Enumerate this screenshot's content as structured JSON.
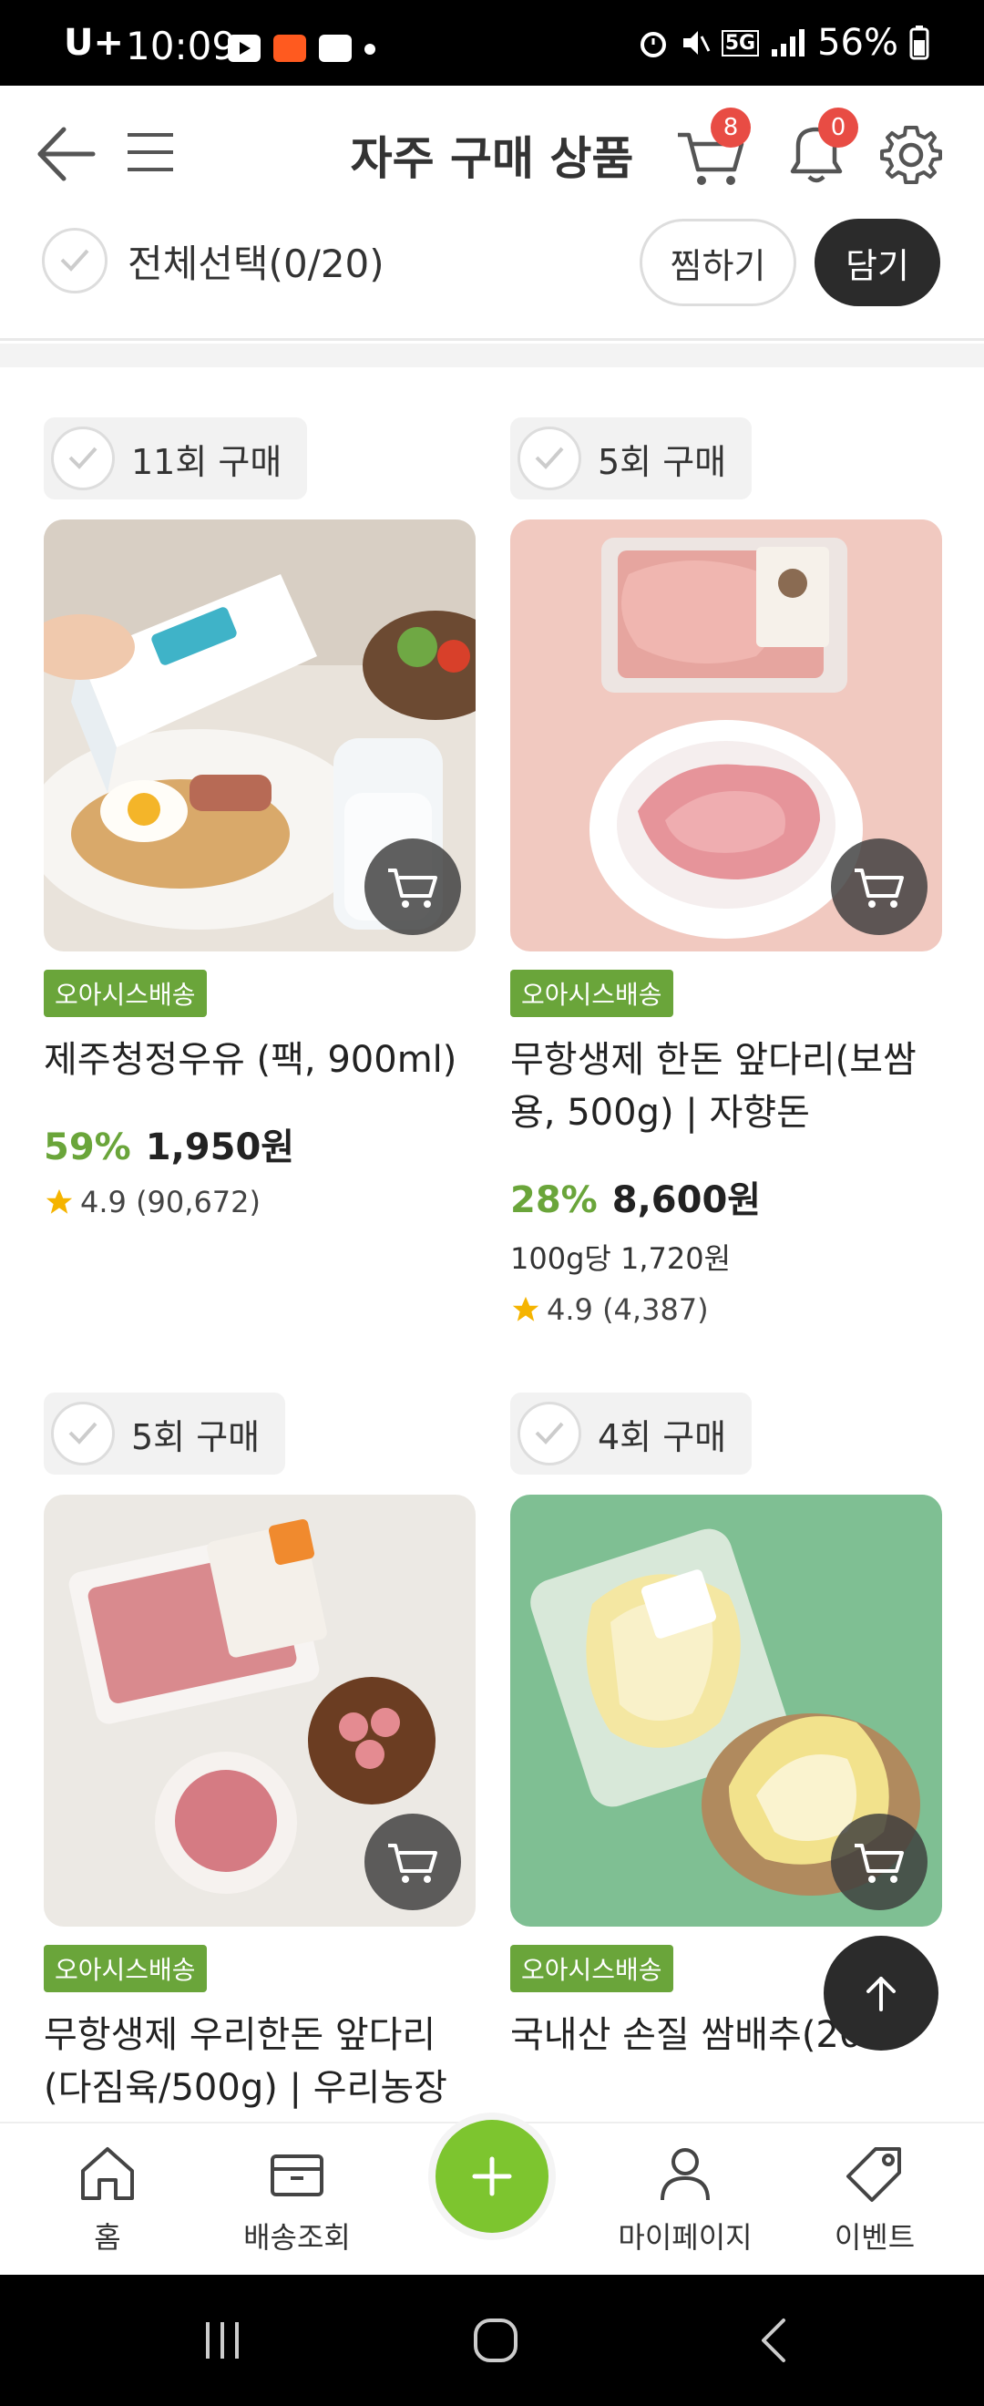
{
  "status_bar": {
    "carrier": "U+",
    "time": "10:09",
    "network": "5G",
    "battery": "56%"
  },
  "header": {
    "title": "자주 구매 상품",
    "cart_count": "8",
    "notification_count": "0"
  },
  "selection": {
    "select_all_label": "전체선택(0/20)",
    "wish_button": "찜하기",
    "add_button": "담기"
  },
  "products": [
    {
      "purchase_count": "11회 구매",
      "delivery": "오아시스배송",
      "name": "제주청정우유 (팩, 900ml)",
      "discount": "59%",
      "price": "1,950원",
      "unit_price": "",
      "rating": "4.9 (90,672)",
      "image": "milk-breakfast"
    },
    {
      "purchase_count": "5회 구매",
      "delivery": "오아시스배송",
      "name": "무항생제 한돈 앞다리(보쌈용, 500g) | 자향돈",
      "discount": "28%",
      "price": "8,600원",
      "unit_price": "100g당 1,720원",
      "rating": "4.9 (4,387)",
      "image": "pork-shoulder"
    },
    {
      "purchase_count": "5회 구매",
      "delivery": "오아시스배송",
      "name": "무항생제 우리한돈 앞다리(다짐육/500g) | 우리농장",
      "discount": "",
      "price": "",
      "unit_price": "",
      "rating": "",
      "image": "ground-pork"
    },
    {
      "purchase_count": "4회 구매",
      "delivery": "오아시스배송",
      "name": "국내산 손질 쌈배추(20",
      "discount": "",
      "price": "",
      "unit_price": "",
      "rating": "",
      "image": "napa-cabbage"
    }
  ],
  "bottom_nav": {
    "home": "홈",
    "delivery": "배송조회",
    "mypage": "마이페이지",
    "event": "이벤트"
  },
  "colors": {
    "accent_green": "#6aa53a",
    "fab_green": "#7dc52f",
    "badge_red": "#e84c44",
    "dark": "#2b2b2b"
  }
}
